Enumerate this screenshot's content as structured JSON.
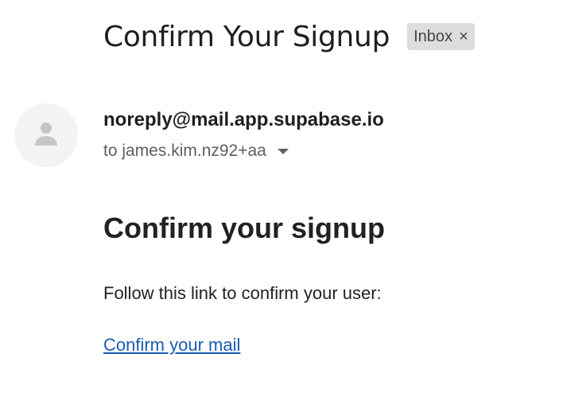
{
  "header": {
    "subject": "Confirm Your Signup",
    "label_chip": {
      "text": "Inbox",
      "close_glyph": "×"
    }
  },
  "message": {
    "avatar_icon": "person-icon",
    "sender": "noreply@mail.app.supabase.io",
    "recipient": "to james.kim.nz92+aa",
    "details_icon": "caret-down-icon"
  },
  "body": {
    "heading": "Confirm your signup",
    "paragraph": "Follow this link to confirm your user:",
    "link_text": "Confirm your mail"
  },
  "colors": {
    "link": "#1a5cb3",
    "chip_background": "#dddddd",
    "avatar_background": "#f1f3f4",
    "avatar_glyph": "#c6c6c6"
  }
}
